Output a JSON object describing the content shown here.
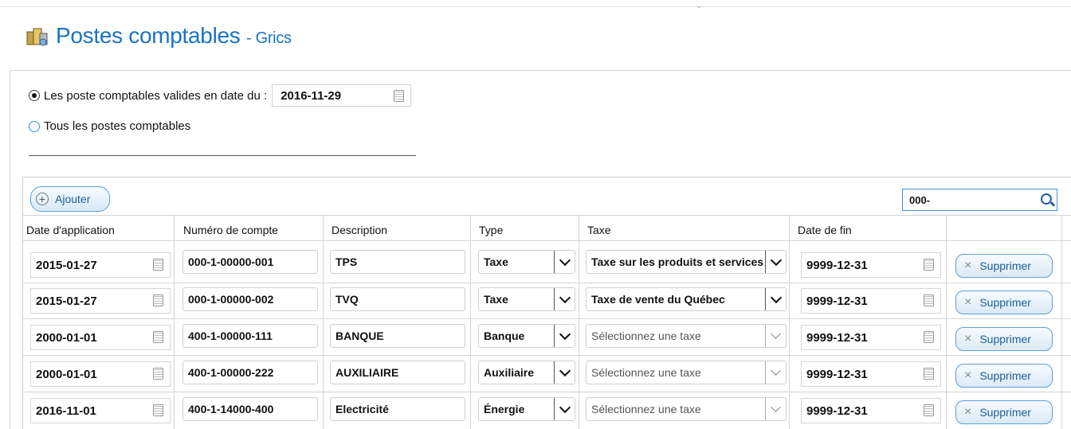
{
  "header": {
    "title": "Postes comptables",
    "subtitle": "- Grics"
  },
  "filter": {
    "valid_label": "Les poste comptables valides en date du :",
    "valid_date": "2016-11-29",
    "all_label": "Tous les postes comptables",
    "selected": "valid"
  },
  "toolbar": {
    "add_label": "Ajouter",
    "search_value": "000-"
  },
  "columns": [
    "Date d'application",
    "Numéro de compte",
    "Description",
    "Type",
    "Taxe",
    "Date de fin"
  ],
  "rows": [
    {
      "date_application": "2015-01-27",
      "compte": "000-1-00000-001",
      "description": "TPS",
      "type": "Taxe",
      "taxe": "Taxe sur les produits et services",
      "taxe_placeholder": false,
      "date_fin": "9999-12-31",
      "delete_label": "Supprimer"
    },
    {
      "date_application": "2015-01-27",
      "compte": "000-1-00000-002",
      "description": "TVQ",
      "type": "Taxe",
      "taxe": "Taxe de vente du Québec",
      "taxe_placeholder": false,
      "date_fin": "9999-12-31",
      "delete_label": "Supprimer"
    },
    {
      "date_application": "2000-01-01",
      "compte": "400-1-00000-111",
      "description": "BANQUE",
      "type": "Banque",
      "taxe": "Sélectionnez une taxe",
      "taxe_placeholder": true,
      "date_fin": "9999-12-31",
      "delete_label": "Supprimer"
    },
    {
      "date_application": "2000-01-01",
      "compte": "400-1-00000-222",
      "description": "AUXILIAIRE",
      "type": "Auxiliaire",
      "taxe": "Sélectionnez une taxe",
      "taxe_placeholder": true,
      "date_fin": "9999-12-31",
      "delete_label": "Supprimer"
    },
    {
      "date_application": "2016-11-01",
      "compte": "400-1-14000-400",
      "description": "Electricité",
      "type": "Énergie",
      "taxe": "Sélectionnez une taxe",
      "taxe_placeholder": true,
      "date_fin": "9999-12-31",
      "delete_label": "Supprimer"
    }
  ],
  "colors": {
    "accent": "#1a73c6",
    "button_border": "#5aa0d8"
  }
}
